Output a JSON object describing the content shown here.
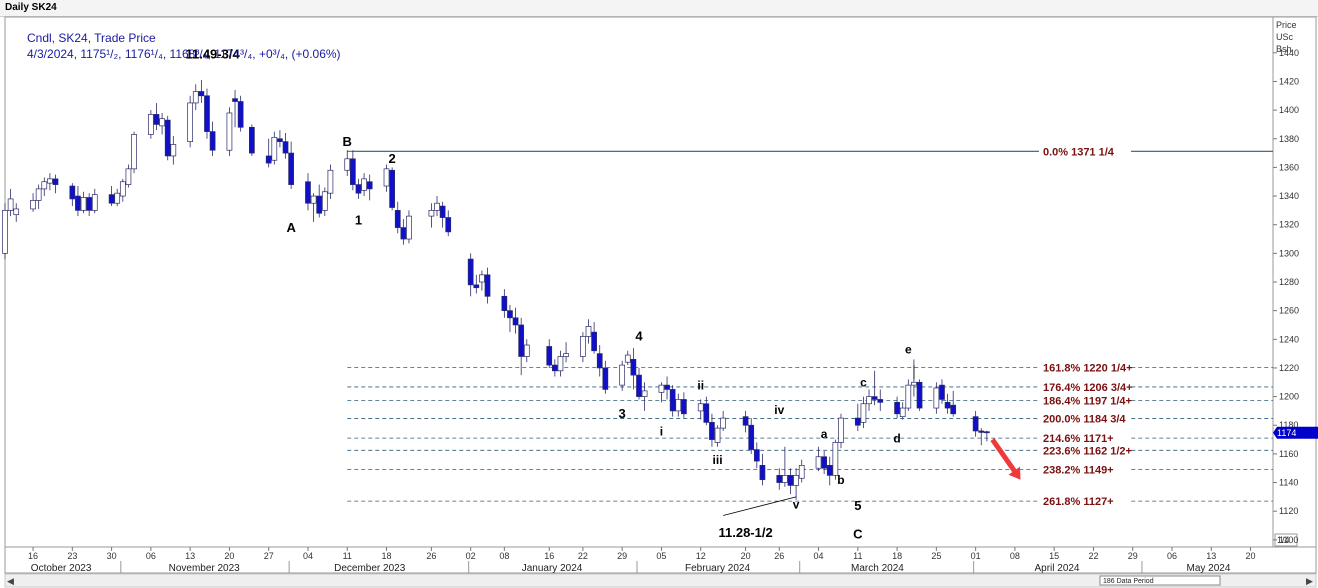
{
  "window": {
    "title": "Daily SK24",
    "scale_header": [
      "Price",
      "USc",
      "Bsh"
    ],
    "current_price_label": "1174",
    "period_label": "186 Data Period",
    "fraction_button": "1/4",
    "scroll_left": "◀",
    "scroll_right": "▶"
  },
  "legend": {
    "line1": "Cndl, SK24, Trade Price",
    "line2": "4/3/2024, 1175¹/₂, 1176¹/₄, 1168³/₄, 1174³/₄, +0³/₄, (+0.06%)"
  },
  "colors": {
    "up_candle": "#ffffff",
    "down_candle": "#1010c8",
    "candle_outline": "#2a2a6a",
    "fib_line": "#2f5d7a",
    "fib_text": "#7a1010",
    "legend_text": "#1a1aa0",
    "arrow": "#ee3a3a",
    "price_tag": "#0000cc"
  },
  "annotations": {
    "high": "11.49-3/4",
    "low": "11.28-1/2",
    "wave_A": "A",
    "wave_B": "B",
    "wave_C": "C",
    "wave_1": "1",
    "wave_2": "2",
    "wave_3": "3",
    "wave_4": "4",
    "wave_5": "5",
    "wave_i": "i",
    "wave_ii": "ii",
    "wave_iii": "iii",
    "wave_iv": "iv",
    "wave_v": "v",
    "wave_a": "a",
    "wave_b": "b",
    "wave_c": "c",
    "wave_d": "d",
    "wave_e": "e"
  },
  "fib_levels": [
    {
      "label": "0.0%   1371 1/4",
      "value": 1371.25
    },
    {
      "label": "161.8% 1220 1/4+",
      "value": 1220.25
    },
    {
      "label": "176.4% 1206 3/4+",
      "value": 1206.75
    },
    {
      "label": "186.4% 1197 1/4+",
      "value": 1197.25
    },
    {
      "label": "200.0% 1184 3/4",
      "value": 1184.75
    },
    {
      "label": "214.6% 1171+",
      "value": 1171
    },
    {
      "label": "223.6% 1162 1/2+",
      "value": 1162.5
    },
    {
      "label": "238.2% 1149+",
      "value": 1149
    },
    {
      "label": "261.8% 1127+",
      "value": 1127
    }
  ],
  "x_axis": {
    "day_ticks": [
      {
        "label": "16",
        "date": "2023-10-16"
      },
      {
        "label": "23",
        "date": "2023-10-23"
      },
      {
        "label": "30",
        "date": "2023-10-30"
      },
      {
        "label": "06",
        "date": "2023-11-06"
      },
      {
        "label": "13",
        "date": "2023-11-13"
      },
      {
        "label": "20",
        "date": "2023-11-20"
      },
      {
        "label": "27",
        "date": "2023-11-27"
      },
      {
        "label": "04",
        "date": "2023-12-04"
      },
      {
        "label": "11",
        "date": "2023-12-11"
      },
      {
        "label": "18",
        "date": "2023-12-18"
      },
      {
        "label": "26",
        "date": "2023-12-26"
      },
      {
        "label": "02",
        "date": "2024-01-02"
      },
      {
        "label": "08",
        "date": "2024-01-08"
      },
      {
        "label": "16",
        "date": "2024-01-16"
      },
      {
        "label": "22",
        "date": "2024-01-22"
      },
      {
        "label": "29",
        "date": "2024-01-29"
      },
      {
        "label": "05",
        "date": "2024-02-05"
      },
      {
        "label": "12",
        "date": "2024-02-12"
      },
      {
        "label": "20",
        "date": "2024-02-20"
      },
      {
        "label": "26",
        "date": "2024-02-26"
      },
      {
        "label": "04",
        "date": "2024-03-04"
      },
      {
        "label": "11",
        "date": "2024-03-11"
      },
      {
        "label": "18",
        "date": "2024-03-18"
      },
      {
        "label": "25",
        "date": "2024-03-25"
      },
      {
        "label": "01",
        "date": "2024-04-01"
      },
      {
        "label": "08",
        "date": "2024-04-08"
      },
      {
        "label": "15",
        "date": "2024-04-15"
      },
      {
        "label": "22",
        "date": "2024-04-22"
      },
      {
        "label": "29",
        "date": "2024-04-29"
      },
      {
        "label": "06",
        "date": "2024-05-06"
      },
      {
        "label": "13",
        "date": "2024-05-13"
      },
      {
        "label": "20",
        "date": "2024-05-20"
      }
    ],
    "months": [
      {
        "label": "October 2023",
        "start": "2023-10-11",
        "end": "2023-10-31"
      },
      {
        "label": "November 2023",
        "start": "2023-11-01",
        "end": "2023-11-30"
      },
      {
        "label": "December 2023",
        "start": "2023-12-01",
        "end": "2023-12-29"
      },
      {
        "label": "January 2024",
        "start": "2024-01-02",
        "end": "2024-01-31"
      },
      {
        "label": "February 2024",
        "start": "2024-02-01",
        "end": "2024-02-29"
      },
      {
        "label": "March 2024",
        "start": "2024-03-01",
        "end": "2024-03-28"
      },
      {
        "label": "April 2024",
        "start": "2024-04-01",
        "end": "2024-04-30"
      },
      {
        "label": "May 2024",
        "start": "2024-05-01",
        "end": "2024-05-24"
      }
    ]
  },
  "chart_data": {
    "type": "candlestick",
    "title": "Daily SK24",
    "ylabel": "Price USc Bsh",
    "ylim": [
      1095,
      1465
    ],
    "y_ticks": [
      1100,
      1120,
      1140,
      1160,
      1180,
      1200,
      1220,
      1240,
      1260,
      1280,
      1300,
      1320,
      1340,
      1360,
      1380,
      1400,
      1420,
      1440
    ],
    "xlim": [
      "2023-10-11",
      "2024-05-24"
    ],
    "grid": false,
    "bars": [
      [
        "2023-10-11",
        1300,
        1335,
        1296,
        1330
      ],
      [
        "2023-10-12",
        1330,
        1345,
        1326,
        1338
      ],
      [
        "2023-10-13",
        1327,
        1335,
        1322,
        1331
      ],
      [
        "2023-10-16",
        1331,
        1342,
        1329,
        1337
      ],
      [
        "2023-10-17",
        1337,
        1348,
        1331,
        1345
      ],
      [
        "2023-10-18",
        1345,
        1353,
        1340,
        1350
      ],
      [
        "2023-10-19",
        1349,
        1356,
        1344,
        1352
      ],
      [
        "2023-10-20",
        1352,
        1355,
        1342,
        1348
      ],
      [
        "2023-10-23",
        1347,
        1349,
        1333,
        1338
      ],
      [
        "2023-10-24",
        1340,
        1347,
        1326,
        1330
      ],
      [
        "2023-10-25",
        1330,
        1343,
        1328,
        1339
      ],
      [
        "2023-10-26",
        1339,
        1342,
        1326,
        1330
      ],
      [
        "2023-10-27",
        1330,
        1345,
        1328,
        1341
      ],
      [
        "2023-10-30",
        1341,
        1347,
        1333,
        1335
      ],
      [
        "2023-10-31",
        1335,
        1345,
        1333,
        1342
      ],
      [
        "2023-11-01",
        1340,
        1352,
        1336,
        1350
      ],
      [
        "2023-11-02",
        1348,
        1362,
        1346,
        1359
      ],
      [
        "2023-11-03",
        1359,
        1385,
        1356,
        1383
      ],
      [
        "2023-11-06",
        1383,
        1400,
        1380,
        1397
      ],
      [
        "2023-11-07",
        1397,
        1405,
        1386,
        1390
      ],
      [
        "2023-11-08",
        1389,
        1398,
        1383,
        1394
      ],
      [
        "2023-11-09",
        1393,
        1396,
        1365,
        1368
      ],
      [
        "2023-11-10",
        1368,
        1382,
        1362,
        1376
      ],
      [
        "2023-11-13",
        1378,
        1410,
        1374,
        1405
      ],
      [
        "2023-11-14",
        1405,
        1418,
        1400,
        1413
      ],
      [
        "2023-11-15",
        1413,
        1421,
        1405,
        1410
      ],
      [
        "2023-11-16",
        1410,
        1415,
        1380,
        1385
      ],
      [
        "2023-11-17",
        1385,
        1392,
        1368,
        1372
      ],
      [
        "2023-11-20",
        1372,
        1402,
        1368,
        1398
      ],
      [
        "2023-11-21",
        1408,
        1414,
        1388,
        1406
      ],
      [
        "2023-11-22",
        1406,
        1410,
        1385,
        1388
      ],
      [
        "2023-11-24",
        1388,
        1390,
        1368,
        1370
      ],
      [
        "2023-11-27",
        1368,
        1380,
        1360,
        1363
      ],
      [
        "2023-11-28",
        1365,
        1385,
        1362,
        1381
      ],
      [
        "2023-11-29",
        1380,
        1386,
        1374,
        1378
      ],
      [
        "2023-11-30",
        1378,
        1384,
        1366,
        1370
      ],
      [
        "2023-12-01",
        1370,
        1378,
        1345,
        1348
      ],
      [
        "2023-12-04",
        1350,
        1356,
        1330,
        1335
      ],
      [
        "2023-12-05",
        1335,
        1342,
        1322,
        1340
      ],
      [
        "2023-12-06",
        1340,
        1348,
        1325,
        1328
      ],
      [
        "2023-12-07",
        1330,
        1346,
        1326,
        1343
      ],
      [
        "2023-12-08",
        1342,
        1362,
        1338,
        1358
      ],
      [
        "2023-12-11",
        1358,
        1372,
        1354,
        1366
      ],
      [
        "2023-12-12",
        1366,
        1372,
        1344,
        1348
      ],
      [
        "2023-12-13",
        1348,
        1352,
        1338,
        1342
      ],
      [
        "2023-12-14",
        1344,
        1356,
        1340,
        1352
      ],
      [
        "2023-12-15",
        1350,
        1355,
        1337,
        1345
      ],
      [
        "2023-12-18",
        1347,
        1362,
        1343,
        1359
      ],
      [
        "2023-12-19",
        1358,
        1360,
        1330,
        1332
      ],
      [
        "2023-12-20",
        1330,
        1336,
        1314,
        1318
      ],
      [
        "2023-12-21",
        1318,
        1324,
        1306,
        1310
      ],
      [
        "2023-12-22",
        1310,
        1330,
        1307,
        1326
      ],
      [
        "2023-12-26",
        1326,
        1335,
        1318,
        1330
      ],
      [
        "2023-12-27",
        1330,
        1340,
        1326,
        1335
      ],
      [
        "2023-12-28",
        1333,
        1336,
        1318,
        1325
      ],
      [
        "2023-12-29",
        1325,
        1330,
        1312,
        1315
      ],
      [
        "2024-01-02",
        1296,
        1300,
        1270,
        1278
      ],
      [
        "2024-01-03",
        1278,
        1285,
        1272,
        1276
      ],
      [
        "2024-01-04",
        1280,
        1288,
        1274,
        1285
      ],
      [
        "2024-01-05",
        1285,
        1290,
        1265,
        1270
      ],
      [
        "2024-01-08",
        1270,
        1275,
        1255,
        1260
      ],
      [
        "2024-01-09",
        1260,
        1264,
        1245,
        1255
      ],
      [
        "2024-01-10",
        1255,
        1262,
        1244,
        1250
      ],
      [
        "2024-01-11",
        1250,
        1255,
        1215,
        1228
      ],
      [
        "2024-01-12",
        1228,
        1240,
        1224,
        1236
      ],
      [
        "2024-01-16",
        1235,
        1240,
        1220,
        1222
      ],
      [
        "2024-01-17",
        1222,
        1226,
        1214,
        1218
      ],
      [
        "2024-01-18",
        1218,
        1232,
        1214,
        1228
      ],
      [
        "2024-01-19",
        1228,
        1238,
        1224,
        1230
      ],
      [
        "2024-01-22",
        1228,
        1245,
        1224,
        1242
      ],
      [
        "2024-01-23",
        1242,
        1254,
        1237,
        1249
      ],
      [
        "2024-01-24",
        1245,
        1252,
        1230,
        1232
      ],
      [
        "2024-01-25",
        1230,
        1236,
        1214,
        1220
      ],
      [
        "2024-01-26",
        1220,
        1225,
        1202,
        1205
      ],
      [
        "2024-01-29",
        1208,
        1225,
        1204,
        1222
      ],
      [
        "2024-01-30",
        1224,
        1232,
        1222,
        1229
      ],
      [
        "2024-01-31",
        1226,
        1234,
        1205,
        1215
      ],
      [
        "2024-02-01",
        1215,
        1220,
        1198,
        1200
      ],
      [
        "2024-02-02",
        1200,
        1210,
        1190,
        1204
      ],
      [
        "2024-02-05",
        1203,
        1210,
        1196,
        1208
      ],
      [
        "2024-02-06",
        1208,
        1214,
        1198,
        1205
      ],
      [
        "2024-02-07",
        1205,
        1208,
        1186,
        1190
      ],
      [
        "2024-02-08",
        1190,
        1202,
        1186,
        1198
      ],
      [
        "2024-02-09",
        1198,
        1203,
        1185,
        1188
      ],
      [
        "2024-02-12",
        1190,
        1198,
        1184,
        1195
      ],
      [
        "2024-02-13",
        1195,
        1200,
        1180,
        1182
      ],
      [
        "2024-02-14",
        1182,
        1188,
        1165,
        1170
      ],
      [
        "2024-02-15",
        1168,
        1180,
        1165,
        1178
      ],
      [
        "2024-02-16",
        1178,
        1190,
        1176,
        1185
      ],
      [
        "2024-02-20",
        1186,
        1190,
        1175,
        1180
      ],
      [
        "2024-02-21",
        1180,
        1185,
        1160,
        1163
      ],
      [
        "2024-02-22",
        1163,
        1168,
        1150,
        1155
      ],
      [
        "2024-02-23",
        1152,
        1160,
        1138,
        1142
      ],
      [
        "2024-02-26",
        1145,
        1150,
        1135,
        1140
      ],
      [
        "2024-02-27",
        1140,
        1165,
        1137,
        1145
      ],
      [
        "2024-02-28",
        1145,
        1150,
        1132,
        1138
      ],
      [
        "2024-02-29",
        1138,
        1150,
        1128,
        1145
      ],
      [
        "2024-03-01",
        1143,
        1156,
        1140,
        1152
      ],
      [
        "2024-03-04",
        1150,
        1165,
        1148,
        1158
      ],
      [
        "2024-03-05",
        1158,
        1162,
        1146,
        1150
      ],
      [
        "2024-03-06",
        1152,
        1158,
        1138,
        1145
      ],
      [
        "2024-03-07",
        1145,
        1170,
        1142,
        1168
      ],
      [
        "2024-03-08",
        1168,
        1188,
        1164,
        1185
      ],
      [
        "2024-03-11",
        1185,
        1195,
        1176,
        1180
      ],
      [
        "2024-03-12",
        1182,
        1200,
        1178,
        1195
      ],
      [
        "2024-03-13",
        1195,
        1205,
        1190,
        1200
      ],
      [
        "2024-03-14",
        1200,
        1218,
        1194,
        1198
      ],
      [
        "2024-03-15",
        1198,
        1205,
        1190,
        1196
      ],
      [
        "2024-03-18",
        1196,
        1200,
        1185,
        1188
      ],
      [
        "2024-03-19",
        1186,
        1196,
        1184,
        1192
      ],
      [
        "2024-03-20",
        1192,
        1212,
        1190,
        1208
      ],
      [
        "2024-03-21",
        1208,
        1226,
        1200,
        1210
      ],
      [
        "2024-03-22",
        1210,
        1212,
        1190,
        1192
      ],
      [
        "2024-03-25",
        1192,
        1210,
        1188,
        1206
      ],
      [
        "2024-03-26",
        1208,
        1212,
        1195,
        1198
      ],
      [
        "2024-03-27",
        1196,
        1202,
        1188,
        1192
      ],
      [
        "2024-03-28",
        1194,
        1204,
        1186,
        1188
      ],
      [
        "2024-04-01",
        1186,
        1190,
        1172,
        1176
      ],
      [
        "2024-04-02",
        1176,
        1178,
        1166,
        1175
      ],
      [
        "2024-04-03",
        1175.5,
        1176.25,
        1168.75,
        1174.75
      ]
    ]
  }
}
